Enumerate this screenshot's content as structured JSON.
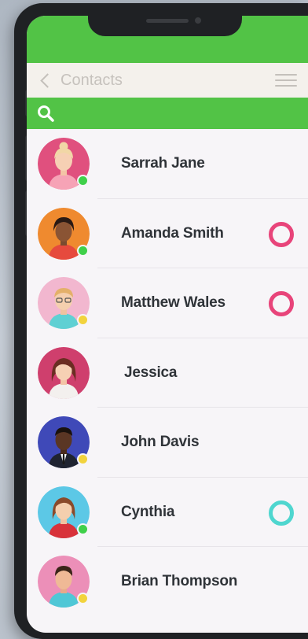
{
  "header": {
    "title": "Contacts"
  },
  "colors": {
    "accent": "#52c346",
    "online": "#3fd04a",
    "away": "#f2d33d",
    "ring_pink": "#e8447a",
    "ring_teal": "#4fd6cf"
  },
  "contacts": [
    {
      "name": "Sarrah Jane",
      "presence": "online",
      "ring": null
    },
    {
      "name": "Amanda Smith",
      "presence": "online",
      "ring": "pink"
    },
    {
      "name": "Matthew Wales",
      "presence": "away",
      "ring": "pink"
    },
    {
      "name": "Jessica",
      "presence": null,
      "ring": null
    },
    {
      "name": "John Davis",
      "presence": "away",
      "ring": null
    },
    {
      "name": "Cynthia",
      "presence": "online",
      "ring": "teal"
    },
    {
      "name": "Brian Thompson",
      "presence": "away",
      "ring": null
    }
  ]
}
